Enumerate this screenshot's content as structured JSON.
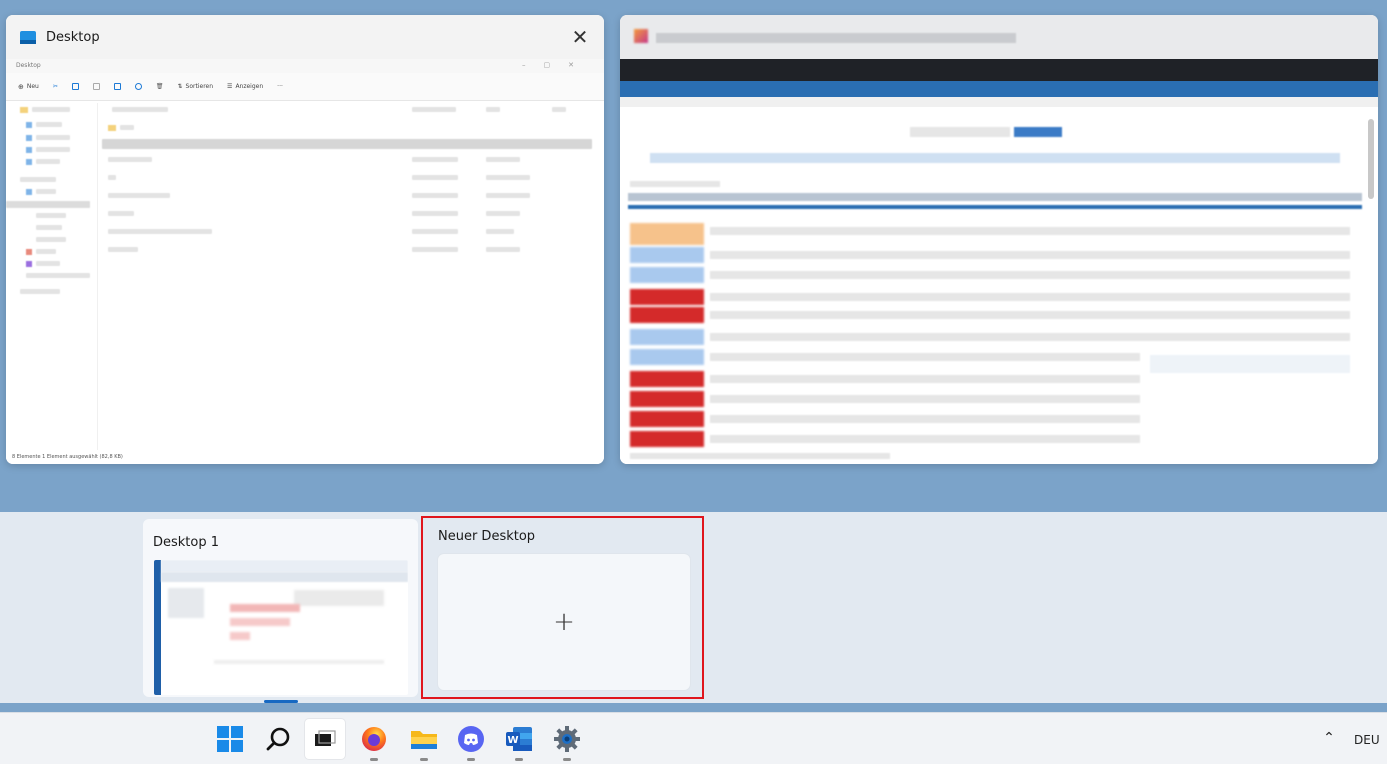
{
  "windows": {
    "explorer": {
      "title": "Desktop",
      "inner_title": "Desktop",
      "toolbar": {
        "new_label": "Neu",
        "sort_label": "Sortieren",
        "view_label": "Anzeigen",
        "more_label": "···"
      },
      "status_text": "8 Elemente    1 Element ausgewählt (82,8 KB)"
    },
    "browser": {
      "title": ""
    }
  },
  "desktops": {
    "items": [
      {
        "label": "Desktop 1"
      },
      {
        "label": "Neuer Desktop"
      }
    ],
    "new_desktop_plus": "+"
  },
  "taskbar": {
    "apps": [
      {
        "name": "start",
        "icon": "windows-logo-icon"
      },
      {
        "name": "search",
        "icon": "search-icon"
      },
      {
        "name": "task-view",
        "icon": "task-view-icon"
      },
      {
        "name": "firefox",
        "icon": "firefox-icon"
      },
      {
        "name": "explorer",
        "icon": "folder-icon"
      },
      {
        "name": "discord",
        "icon": "discord-icon"
      },
      {
        "name": "word",
        "icon": "word-icon"
      },
      {
        "name": "settings",
        "icon": "gear-icon"
      }
    ],
    "tray_chevron": "⌃",
    "language": "DEU"
  },
  "colors": {
    "backdrop": "#7ba3c9",
    "highlight_border": "#e0161d",
    "accent": "#1769c2"
  }
}
